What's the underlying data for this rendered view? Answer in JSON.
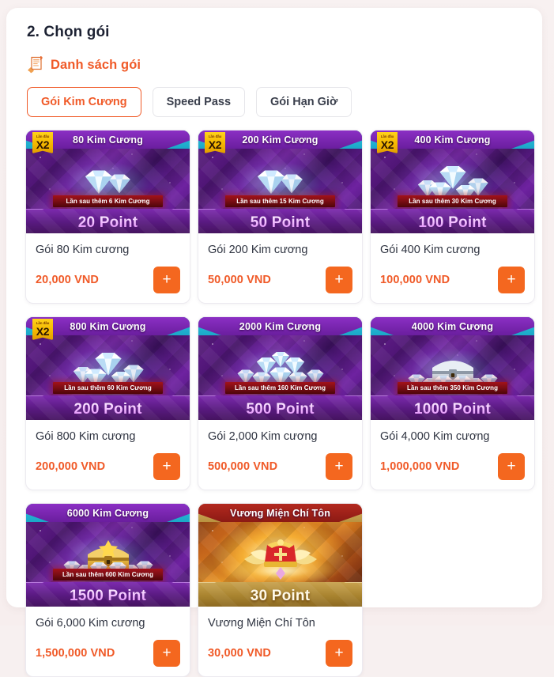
{
  "panel": {
    "title": "2. Chọn gói",
    "section_label": "Danh sách gói",
    "section_icon": "scroll-list-icon"
  },
  "colors": {
    "accent": "#f05a28",
    "add_button": "#f4671f",
    "page_bg": "#f7f0f0",
    "panel_bg": "#ffffff",
    "banner_purple": "#6a1e9e",
    "banner_cyan": "#1ba8c8",
    "ribbon_red": "#7a0d13",
    "badge_gold": "#f5b800",
    "crown_gold": "#c8a24f"
  },
  "tabs": [
    {
      "label": "Gói Kim Cương",
      "active": true
    },
    {
      "label": "Speed Pass",
      "active": false
    },
    {
      "label": "Gói Hạn Giờ",
      "active": false
    }
  ],
  "add_button_label": "+",
  "badge": {
    "top_text": "Lần đầu",
    "main_text": "X2"
  },
  "packages": [
    {
      "banner_title": "80 Kim Cương",
      "ribbon": "Lần sau thêm 6 Kim Cương",
      "point": "20 Point",
      "name": "Gói 80 Kim cương",
      "price": "20,000 VND",
      "has_x2_badge": true,
      "art": "gems-small",
      "theme": "purple"
    },
    {
      "banner_title": "200 Kim Cương",
      "ribbon": "Lần sau thêm 15 Kim Cương",
      "point": "50 Point",
      "name": "Gói 200 Kim cương",
      "price": "50,000 VND",
      "has_x2_badge": true,
      "art": "gems-small",
      "theme": "purple"
    },
    {
      "banner_title": "400 Kim Cương",
      "ribbon": "Lần sau thêm 30 Kim Cương",
      "point": "100 Point",
      "name": "Gói 400 Kim cương",
      "price": "100,000 VND",
      "has_x2_badge": true,
      "art": "gems-medium",
      "theme": "purple"
    },
    {
      "banner_title": "800 Kim Cương",
      "ribbon": "Lần sau thêm 60 Kim Cương",
      "point": "200 Point",
      "name": "Gói 800 Kim cương",
      "price": "200,000 VND",
      "has_x2_badge": true,
      "art": "gems-medium",
      "theme": "purple"
    },
    {
      "banner_title": "2000 Kim Cương",
      "ribbon": "Lần sau thêm 160 Kim Cương",
      "point": "500 Point",
      "name": "Gói 2,000 Kim cương",
      "price": "500,000 VND",
      "has_x2_badge": false,
      "art": "gems-pile",
      "theme": "purple"
    },
    {
      "banner_title": "4000 Kim Cương",
      "ribbon": "Lần sau thêm 350 Kim Cương",
      "point": "1000 Point",
      "name": "Gói 4,000 Kim cương",
      "price": "1,000,000 VND",
      "has_x2_badge": false,
      "art": "chest-silver",
      "theme": "purple"
    },
    {
      "banner_title": "6000 Kim Cương",
      "ribbon": "Lần sau thêm 600 Kim Cương",
      "point": "1500 Point",
      "name": "Gói 6,000 Kim cương",
      "price": "1,500,000 VND",
      "has_x2_badge": false,
      "art": "chest-gold",
      "theme": "purple"
    },
    {
      "banner_title": "Vương Miện Chí Tôn",
      "ribbon": "",
      "point": "30 Point",
      "name": "Vương Miện Chí Tôn",
      "price": "30,000 VND",
      "has_x2_badge": false,
      "art": "crown",
      "theme": "gold"
    }
  ]
}
